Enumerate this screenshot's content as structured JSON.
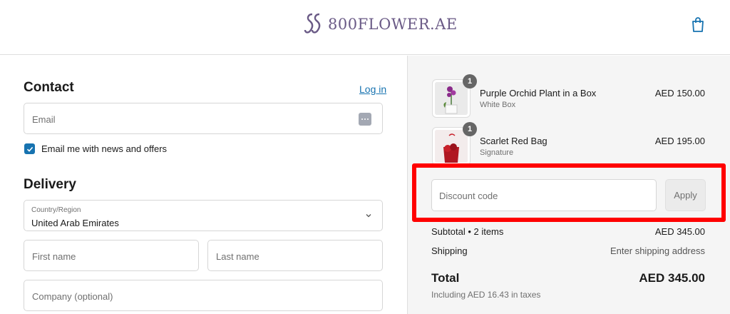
{
  "header": {
    "brand": "800FLOWER.AE",
    "colors": {
      "brand": "#6a5a86",
      "accent": "#1773b0"
    }
  },
  "contact": {
    "title": "Contact",
    "login_label": "Log in",
    "email_placeholder": "Email",
    "newsletter_label": "Email me with news and offers",
    "newsletter_checked": true
  },
  "delivery": {
    "title": "Delivery",
    "country_label": "Country/Region",
    "country_value": "United Arab Emirates",
    "first_name_placeholder": "First name",
    "last_name_placeholder": "Last name",
    "company_placeholder": "Company (optional)"
  },
  "order": {
    "items": [
      {
        "quantity": "1",
        "name": "Purple Orchid Plant in a Box",
        "variant": "White Box",
        "price": "AED 150.00"
      },
      {
        "quantity": "1",
        "name": "Scarlet Red Bag",
        "variant": "Signature",
        "price": "AED 195.00"
      }
    ],
    "discount_placeholder": "Discount code",
    "apply_label": "Apply",
    "subtotal_label": "Subtotal • 2 items",
    "subtotal_value": "AED 345.00",
    "shipping_label": "Shipping",
    "shipping_value": "Enter shipping address",
    "total_label": "Total",
    "total_value": "AED 345.00",
    "tax_note": "Including AED 16.43 in taxes",
    "highlight_color": "#ff0000"
  }
}
